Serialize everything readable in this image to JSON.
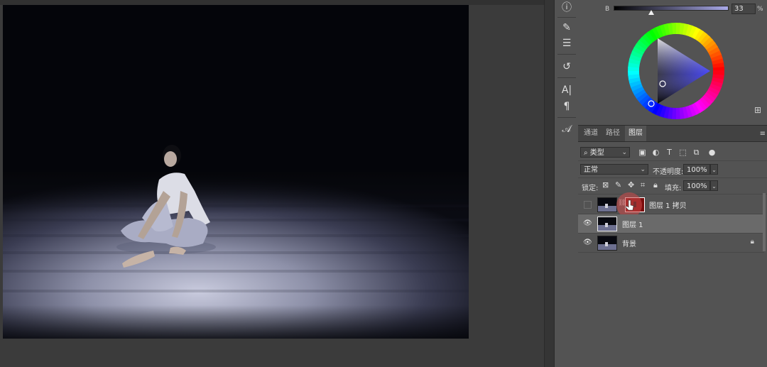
{
  "color_panel": {
    "brightness_label": "B",
    "brightness_value": "33",
    "brightness_unit": "%",
    "brightness_fraction": 0.33,
    "expand_icon": "plus-square-icon"
  },
  "tools": [
    {
      "name": "info-icon",
      "glyph": "ⓘ"
    },
    {
      "name": "brush-settings-icon",
      "glyph": "✎"
    },
    {
      "name": "brush-presets-icon",
      "glyph": "☰"
    },
    {
      "name": "history-icon",
      "glyph": "↺"
    },
    {
      "name": "character-icon",
      "glyph": "A|"
    },
    {
      "name": "paragraph-icon",
      "glyph": "¶"
    },
    {
      "name": "glyphs-icon",
      "glyph": "𝒜"
    }
  ],
  "tabs": [
    {
      "label": "通道",
      "active": false
    },
    {
      "label": "路径",
      "active": false
    },
    {
      "label": "图层",
      "active": true
    }
  ],
  "filter": {
    "kind_label": "类型"
  },
  "blend": {
    "mode": "正常",
    "opacity_label": "不透明度:",
    "opacity_value": "100%"
  },
  "lock": {
    "label": "锁定:",
    "fill_label": "填充:",
    "fill_value": "100%"
  },
  "layers": [
    {
      "name": "图层 1 拷贝",
      "visible": false,
      "selected": false,
      "has_mask": true
    },
    {
      "name": "图层 1",
      "visible": true,
      "selected": true,
      "has_mask": false
    },
    {
      "name": "背景",
      "visible": true,
      "selected": false,
      "locked": true
    }
  ]
}
